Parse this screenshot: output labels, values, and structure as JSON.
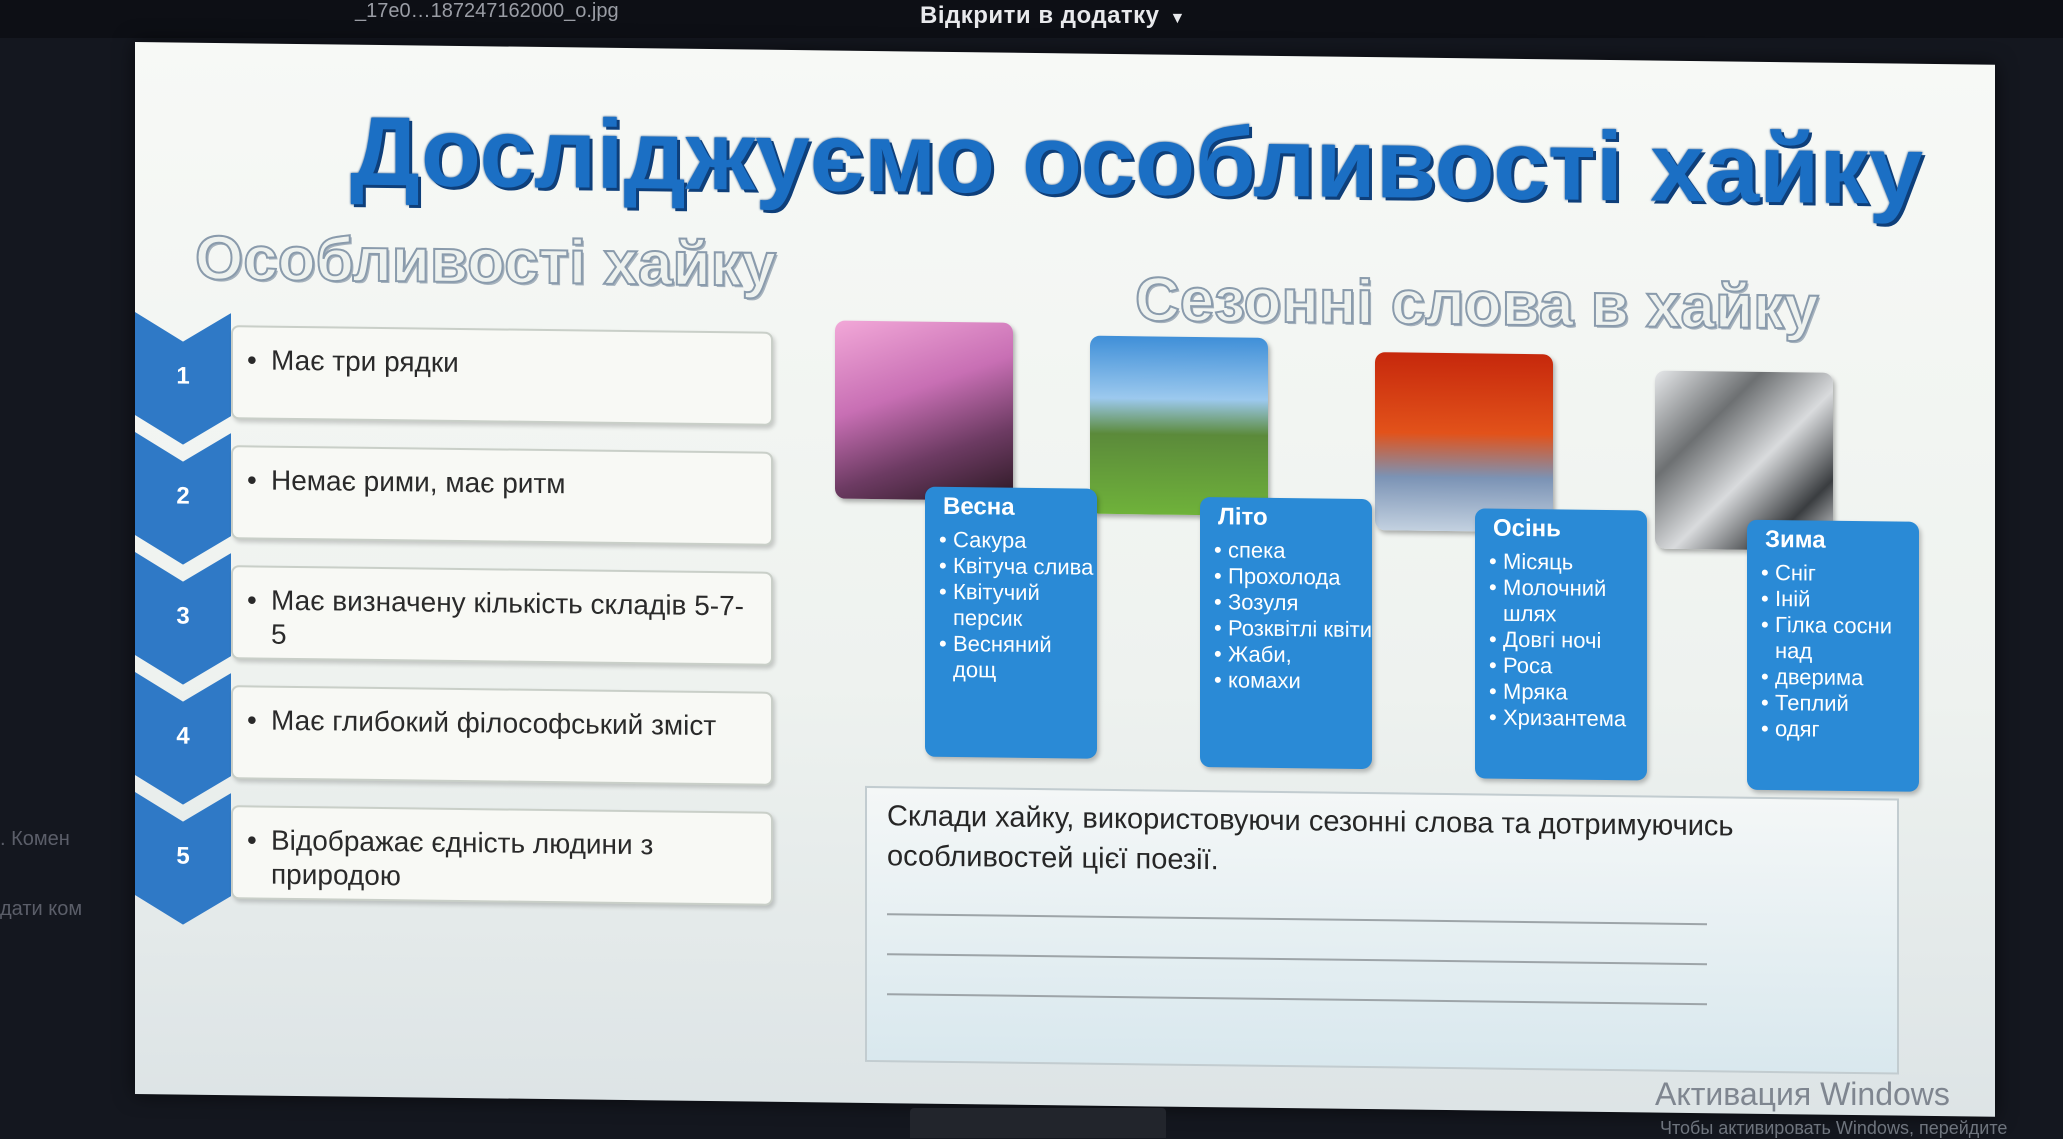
{
  "topbar": {
    "file_name": "_17e0…187247162000_o.jpg",
    "open_in_app": "Відкрити в додатку",
    "open_chevron": "chevron-down-icon"
  },
  "background_text": {
    "line1": ". Комен",
    "line2": "дати ком"
  },
  "slide": {
    "title": "Досліджуємо особливості хайку",
    "left_subtitle": "Особливості хайку",
    "right_subtitle": "Сезонні слова в хайку",
    "features": [
      {
        "num": "1",
        "text": "Має три рядки"
      },
      {
        "num": "2",
        "text": "Немає рими, має ритм"
      },
      {
        "num": "3",
        "text": "Має визначену кількість складів 5-7-5"
      },
      {
        "num": "4",
        "text": "Має глибокий філософський зміст"
      },
      {
        "num": "5",
        "text": "Відображає єдність людини з природою"
      }
    ],
    "seasons": [
      {
        "name": "Весна",
        "image": "sakura-pagoda-image",
        "words": [
          "Сакура",
          "Квітуча слива",
          "Квітучий персик",
          "Весняний дощ"
        ]
      },
      {
        "name": "Літо",
        "image": "green-meadow-mountain-image",
        "words": [
          "спека",
          "Прохолода",
          "Зозуля",
          "Розквітлі квіти",
          "Жаби,",
          "комахи"
        ]
      },
      {
        "name": "Осінь",
        "image": "red-maple-fuji-image",
        "words": [
          "Місяць",
          "Молочний шлях",
          "Довгі ночі",
          "Роса",
          "Мряка",
          "Хризантема"
        ]
      },
      {
        "name": "Зима",
        "image": "snowy-pagoda-image",
        "words": [
          "Сніг",
          "Іній",
          "Гілка сосни над",
          "дверима",
          "Теплий",
          "одяг"
        ]
      }
    ],
    "task": {
      "line1": "Склади хайку, використовуючи сезонні слова та дотримуючись",
      "line2": "особливостей цієї поезії."
    }
  },
  "os_overlay": {
    "activation_title": "Активация Windows",
    "activation_sub": "Чтобы активировать Windows, перейдите"
  },
  "colors": {
    "title_blue": "#1b6fc4",
    "chevron_blue": "#2f79c6",
    "card_blue": "#2a8ad6",
    "arrow_blue": "#86b4e2"
  }
}
